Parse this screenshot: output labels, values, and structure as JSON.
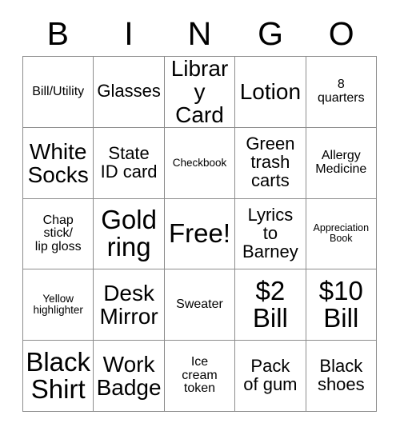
{
  "card": {
    "title": "BINGO",
    "header_letters": [
      "B",
      "I",
      "N",
      "G",
      "O"
    ],
    "columns": 5,
    "rows": 5,
    "free_space": "Free!",
    "colors": {
      "background": "#ffffff",
      "text": "#000000",
      "grid_line": "#8c8c8c"
    },
    "cells": [
      {
        "text": "Bill/Utility",
        "size": "fs-sm"
      },
      {
        "text": "Glasses",
        "size": "fs-md"
      },
      {
        "text": "Library\nCard",
        "size": "fs-lg"
      },
      {
        "text": "Lotion",
        "size": "fs-lg"
      },
      {
        "text": "8\nquarters",
        "size": "fs-sm"
      },
      {
        "text": "White\nSocks",
        "size": "fs-lg"
      },
      {
        "text": "State\nID card",
        "size": "fs-md"
      },
      {
        "text": "Checkbook",
        "size": "fs-xs"
      },
      {
        "text": "Green\ntrash\ncarts",
        "size": "fs-md"
      },
      {
        "text": "Allergy\nMedicine",
        "size": "fs-sm"
      },
      {
        "text": "Chap\nstick/\nlip gloss",
        "size": "fs-sm"
      },
      {
        "text": "Gold\nring",
        "size": "fs-xl"
      },
      {
        "text": "Free!",
        "size": "fs-xl"
      },
      {
        "text": "Lyrics\nto\nBarney",
        "size": "fs-md"
      },
      {
        "text": "Appreciation\nBook",
        "size": "fs-xxs"
      },
      {
        "text": "Yellow\nhighlighter",
        "size": "fs-xs"
      },
      {
        "text": "Desk\nMirror",
        "size": "fs-lg"
      },
      {
        "text": "Sweater",
        "size": "fs-sm"
      },
      {
        "text": "$2\nBill",
        "size": "fs-xl"
      },
      {
        "text": "$10\nBill",
        "size": "fs-xl"
      },
      {
        "text": "Black\nShirt",
        "size": "fs-xl"
      },
      {
        "text": "Work\nBadge",
        "size": "fs-lg"
      },
      {
        "text": "Ice\ncream\ntoken",
        "size": "fs-sm"
      },
      {
        "text": "Pack\nof gum",
        "size": "fs-md"
      },
      {
        "text": "Black\nshoes",
        "size": "fs-md"
      }
    ]
  }
}
